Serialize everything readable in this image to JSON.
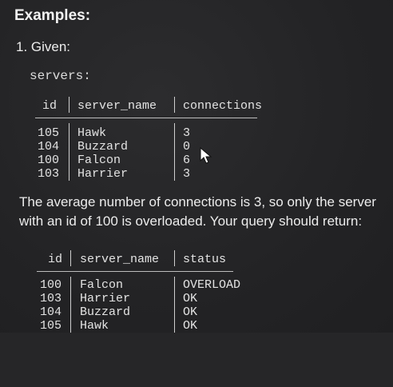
{
  "heading": "Examples:",
  "given": "1. Given:",
  "servers_label": "servers:",
  "servers_table": {
    "headers": [
      "id",
      "server_name",
      "connections"
    ],
    "rows": [
      [
        "105",
        "Hawk",
        "3"
      ],
      [
        "104",
        "Buzzard",
        "0"
      ],
      [
        "100",
        "Falcon",
        "6"
      ],
      [
        "103",
        "Harrier",
        "3"
      ]
    ]
  },
  "paragraph": "The average number of connections is 3, so only the server with an id of 100 is overloaded. Your query should return:",
  "result_table": {
    "headers": [
      "id",
      "server_name",
      "status"
    ],
    "rows": [
      [
        "100",
        "Falcon",
        "OVERLOAD"
      ],
      [
        "103",
        "Harrier",
        "OK"
      ],
      [
        "104",
        "Buzzard",
        "OK"
      ],
      [
        "105",
        "Hawk",
        "OK"
      ]
    ]
  }
}
